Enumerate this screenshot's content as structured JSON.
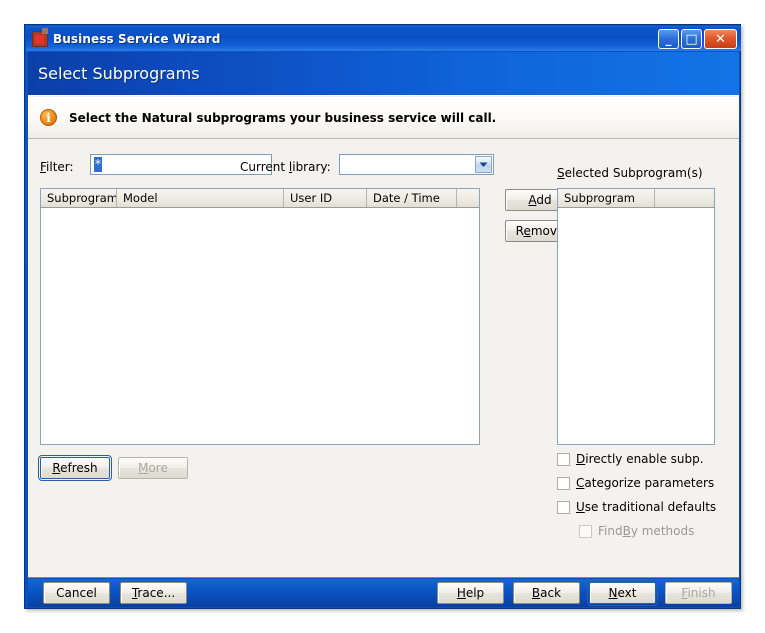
{
  "window": {
    "title": "Business Service Wizard",
    "app_icon": "business-service-icon",
    "buttons": {
      "minimize": "_",
      "maximize": "□",
      "close": "✕"
    }
  },
  "banner": {
    "title": "Select Subprograms"
  },
  "info": {
    "icon": "info-icon",
    "message": "Select the Natural subprograms your business service will call."
  },
  "filter": {
    "label": "Filter:",
    "value": "*",
    "placeholder": ""
  },
  "library": {
    "label": "Current library:",
    "value": "",
    "options": []
  },
  "available_list": {
    "columns": [
      "Subprogram",
      "Model",
      "User ID",
      "Date / Time"
    ],
    "rows": []
  },
  "transfer": {
    "add_label": "Add",
    "remove_label": "Remove"
  },
  "selected_panel": {
    "label": "Selected Subprogram(s)",
    "columns": [
      "Subprogram"
    ],
    "rows": []
  },
  "list_actions": {
    "refresh_label": "Refresh",
    "more_label": "More"
  },
  "options": [
    {
      "label": "Directly enable subp.",
      "checked": false,
      "enabled": true
    },
    {
      "label": "Categorize parameters",
      "checked": false,
      "enabled": true
    },
    {
      "label": "Use traditional defaults",
      "checked": false,
      "enabled": true
    },
    {
      "label": "FindBy methods",
      "checked": false,
      "enabled": false
    }
  ],
  "footer": {
    "cancel_label": "Cancel",
    "trace_label": "Trace...",
    "help_label": "Help",
    "back_label": "Back",
    "next_label": "Next",
    "finish_label": "Finish"
  },
  "colors": {
    "title_bar": "#0a50c4",
    "banner_start": "#0c3fa8",
    "banner_end": "#1274e6",
    "content_bg": "#f3f2ee",
    "info_icon": "#f08a1a",
    "close_button": "#e2572b",
    "selection_highlight": "#2f6fd0"
  }
}
